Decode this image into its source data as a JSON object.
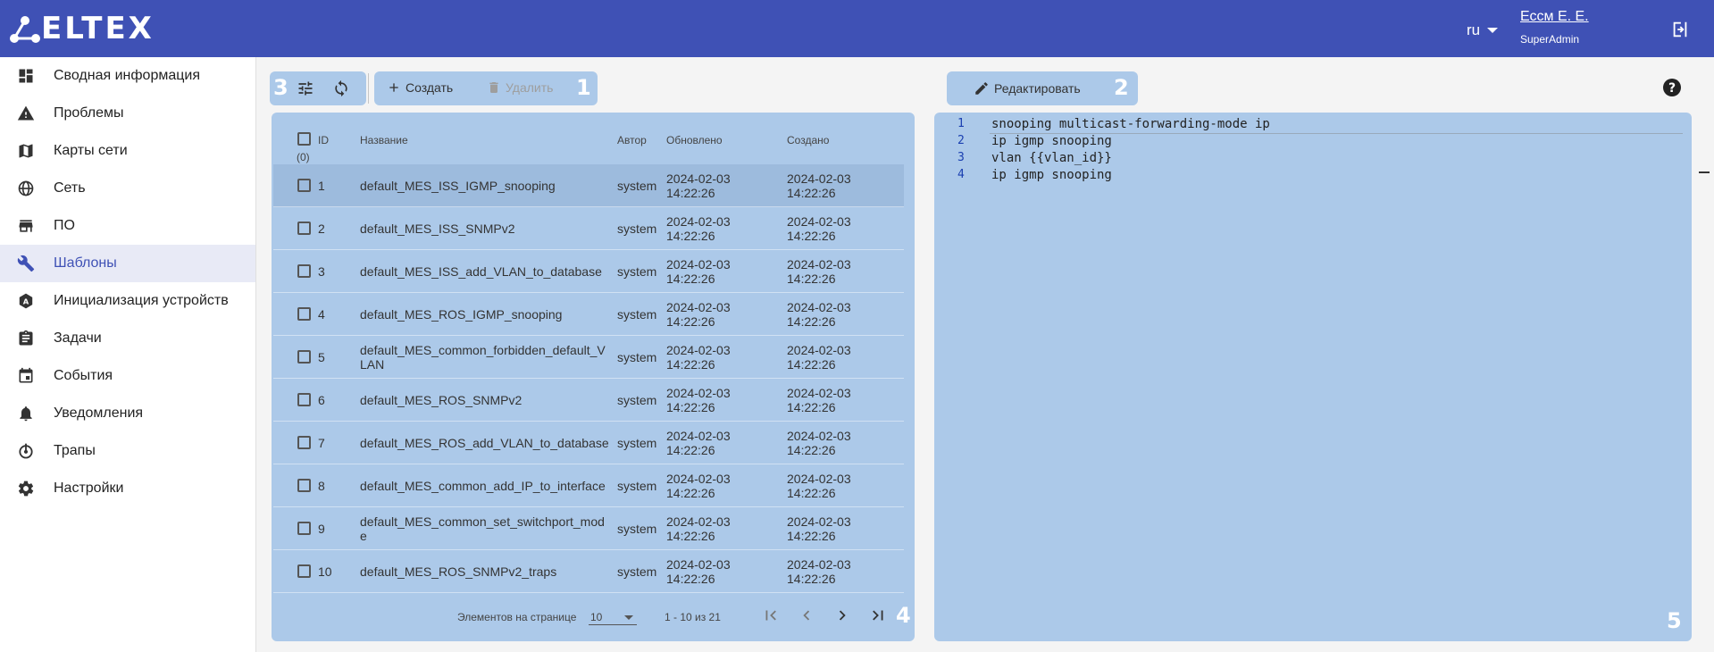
{
  "app": {
    "logo": "ELTEX"
  },
  "header": {
    "language": "ru",
    "user_name": "Ессм Е. Е.",
    "user_role": "SuperAdmin"
  },
  "sidebar": {
    "items": [
      {
        "label": "Сводная информация",
        "icon": "dashboard-icon"
      },
      {
        "label": "Проблемы",
        "icon": "warning-icon"
      },
      {
        "label": "Карты сети",
        "icon": "map-icon"
      },
      {
        "label": "Сеть",
        "icon": "globe-icon"
      },
      {
        "label": "ПО",
        "icon": "store-icon"
      },
      {
        "label": "Шаблоны",
        "icon": "wrench-icon",
        "active": true
      },
      {
        "label": "Инициализация устройств",
        "icon": "auto-device-icon"
      },
      {
        "label": "Задачи",
        "icon": "clipboard-icon"
      },
      {
        "label": "События",
        "icon": "calendar-icon"
      },
      {
        "label": "Уведомления",
        "icon": "bell-icon"
      },
      {
        "label": "Трапы",
        "icon": "trap-icon"
      },
      {
        "label": "Настройки",
        "icon": "gear-icon"
      }
    ]
  },
  "toolbar": {
    "create_label": "Создать",
    "delete_label": "Удалить",
    "edit_label": "Редактировать"
  },
  "markers": {
    "m1": "1",
    "m2": "2",
    "m3": "3",
    "m4": "4",
    "m5": "5"
  },
  "table": {
    "headers": {
      "id": "ID",
      "selected_count": "(0)",
      "name": "Название",
      "author": "Автор",
      "updated": "Обновлено",
      "created": "Создано"
    },
    "rows": [
      {
        "id": "1",
        "name": [
          "default_MES_ISS_IGMP_snooping",
          ""
        ],
        "author": "system",
        "updated": [
          "2024-02-03",
          "14:22:26"
        ],
        "created": [
          "2024-02-03",
          "14:22:26"
        ],
        "selected": true
      },
      {
        "id": "2",
        "name": [
          "default_MES_ISS_SNMPv2",
          ""
        ],
        "author": "system",
        "updated": [
          "2024-02-03",
          "14:22:26"
        ],
        "created": [
          "2024-02-03",
          "14:22:26"
        ]
      },
      {
        "id": "3",
        "name": [
          "default_MES_ISS_add_VLAN_to_database",
          ""
        ],
        "author": "system",
        "updated": [
          "2024-02-03",
          "14:22:26"
        ],
        "created": [
          "2024-02-03",
          "14:22:26"
        ]
      },
      {
        "id": "4",
        "name": [
          "default_MES_ROS_IGMP_snooping",
          ""
        ],
        "author": "system",
        "updated": [
          "2024-02-03",
          "14:22:26"
        ],
        "created": [
          "2024-02-03",
          "14:22:26"
        ]
      },
      {
        "id": "5",
        "name": [
          "default_MES_common_forbidden_default_V",
          "LAN"
        ],
        "author": "system",
        "updated": [
          "2024-02-03",
          "14:22:26"
        ],
        "created": [
          "2024-02-03",
          "14:22:26"
        ]
      },
      {
        "id": "6",
        "name": [
          "default_MES_ROS_SNMPv2",
          ""
        ],
        "author": "system",
        "updated": [
          "2024-02-03",
          "14:22:26"
        ],
        "created": [
          "2024-02-03",
          "14:22:26"
        ]
      },
      {
        "id": "7",
        "name": [
          "default_MES_ROS_add_VLAN_to_database",
          ""
        ],
        "author": "system",
        "updated": [
          "2024-02-03",
          "14:22:26"
        ],
        "created": [
          "2024-02-03",
          "14:22:26"
        ]
      },
      {
        "id": "8",
        "name": [
          "default_MES_common_add_IP_to_interface",
          ""
        ],
        "author": "system",
        "updated": [
          "2024-02-03",
          "14:22:26"
        ],
        "created": [
          "2024-02-03",
          "14:22:26"
        ]
      },
      {
        "id": "9",
        "name": [
          "default_MES_common_set_switchport_mod",
          "e"
        ],
        "author": "system",
        "updated": [
          "2024-02-03",
          "14:22:26"
        ],
        "created": [
          "2024-02-03",
          "14:22:26"
        ]
      },
      {
        "id": "10",
        "name": [
          "default_MES_ROS_SNMPv2_traps",
          ""
        ],
        "author": "system",
        "updated": [
          "2024-02-03",
          "14:22:26"
        ],
        "created": [
          "2024-02-03",
          "14:22:26"
        ]
      }
    ]
  },
  "pagination": {
    "per_page_label": "Элементов на странице",
    "per_page_value": "10",
    "range": "1 - 10 из 21"
  },
  "editor": {
    "lines": [
      {
        "num": "1",
        "text": "snooping multicast-forwarding-mode ip"
      },
      {
        "num": "2",
        "text": "ip igmp snooping"
      },
      {
        "num": "3",
        "text": "vlan {{vlan_id}}"
      },
      {
        "num": "4",
        "text": "ip igmp snooping"
      }
    ]
  },
  "colors": {
    "header": "#3f51b5",
    "highlight": "#acc9e9",
    "active_nav": "#3f51b5"
  }
}
